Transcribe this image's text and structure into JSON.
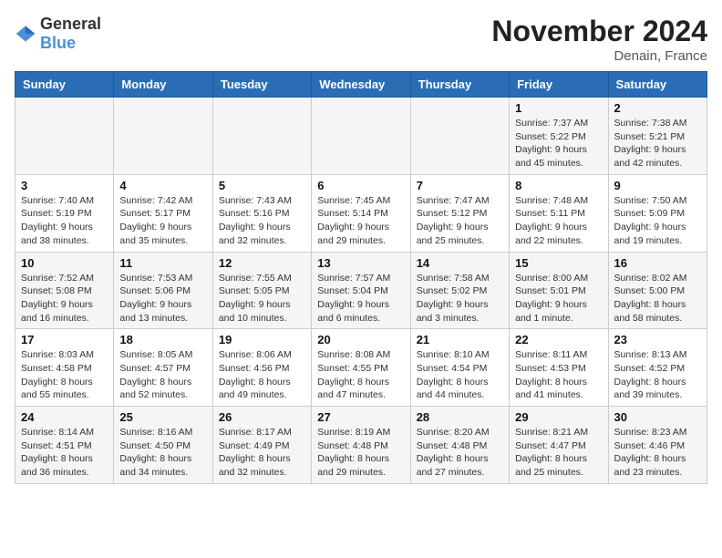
{
  "logo": {
    "general": "General",
    "blue": "Blue"
  },
  "header": {
    "month": "November 2024",
    "location": "Denain, France"
  },
  "days_of_week": [
    "Sunday",
    "Monday",
    "Tuesday",
    "Wednesday",
    "Thursday",
    "Friday",
    "Saturday"
  ],
  "weeks": [
    [
      {
        "day": "",
        "info": ""
      },
      {
        "day": "",
        "info": ""
      },
      {
        "day": "",
        "info": ""
      },
      {
        "day": "",
        "info": ""
      },
      {
        "day": "",
        "info": ""
      },
      {
        "day": "1",
        "info": "Sunrise: 7:37 AM\nSunset: 5:22 PM\nDaylight: 9 hours and 45 minutes."
      },
      {
        "day": "2",
        "info": "Sunrise: 7:38 AM\nSunset: 5:21 PM\nDaylight: 9 hours and 42 minutes."
      }
    ],
    [
      {
        "day": "3",
        "info": "Sunrise: 7:40 AM\nSunset: 5:19 PM\nDaylight: 9 hours and 38 minutes."
      },
      {
        "day": "4",
        "info": "Sunrise: 7:42 AM\nSunset: 5:17 PM\nDaylight: 9 hours and 35 minutes."
      },
      {
        "day": "5",
        "info": "Sunrise: 7:43 AM\nSunset: 5:16 PM\nDaylight: 9 hours and 32 minutes."
      },
      {
        "day": "6",
        "info": "Sunrise: 7:45 AM\nSunset: 5:14 PM\nDaylight: 9 hours and 29 minutes."
      },
      {
        "day": "7",
        "info": "Sunrise: 7:47 AM\nSunset: 5:12 PM\nDaylight: 9 hours and 25 minutes."
      },
      {
        "day": "8",
        "info": "Sunrise: 7:48 AM\nSunset: 5:11 PM\nDaylight: 9 hours and 22 minutes."
      },
      {
        "day": "9",
        "info": "Sunrise: 7:50 AM\nSunset: 5:09 PM\nDaylight: 9 hours and 19 minutes."
      }
    ],
    [
      {
        "day": "10",
        "info": "Sunrise: 7:52 AM\nSunset: 5:08 PM\nDaylight: 9 hours and 16 minutes."
      },
      {
        "day": "11",
        "info": "Sunrise: 7:53 AM\nSunset: 5:06 PM\nDaylight: 9 hours and 13 minutes."
      },
      {
        "day": "12",
        "info": "Sunrise: 7:55 AM\nSunset: 5:05 PM\nDaylight: 9 hours and 10 minutes."
      },
      {
        "day": "13",
        "info": "Sunrise: 7:57 AM\nSunset: 5:04 PM\nDaylight: 9 hours and 6 minutes."
      },
      {
        "day": "14",
        "info": "Sunrise: 7:58 AM\nSunset: 5:02 PM\nDaylight: 9 hours and 3 minutes."
      },
      {
        "day": "15",
        "info": "Sunrise: 8:00 AM\nSunset: 5:01 PM\nDaylight: 9 hours and 1 minute."
      },
      {
        "day": "16",
        "info": "Sunrise: 8:02 AM\nSunset: 5:00 PM\nDaylight: 8 hours and 58 minutes."
      }
    ],
    [
      {
        "day": "17",
        "info": "Sunrise: 8:03 AM\nSunset: 4:58 PM\nDaylight: 8 hours and 55 minutes."
      },
      {
        "day": "18",
        "info": "Sunrise: 8:05 AM\nSunset: 4:57 PM\nDaylight: 8 hours and 52 minutes."
      },
      {
        "day": "19",
        "info": "Sunrise: 8:06 AM\nSunset: 4:56 PM\nDaylight: 8 hours and 49 minutes."
      },
      {
        "day": "20",
        "info": "Sunrise: 8:08 AM\nSunset: 4:55 PM\nDaylight: 8 hours and 47 minutes."
      },
      {
        "day": "21",
        "info": "Sunrise: 8:10 AM\nSunset: 4:54 PM\nDaylight: 8 hours and 44 minutes."
      },
      {
        "day": "22",
        "info": "Sunrise: 8:11 AM\nSunset: 4:53 PM\nDaylight: 8 hours and 41 minutes."
      },
      {
        "day": "23",
        "info": "Sunrise: 8:13 AM\nSunset: 4:52 PM\nDaylight: 8 hours and 39 minutes."
      }
    ],
    [
      {
        "day": "24",
        "info": "Sunrise: 8:14 AM\nSunset: 4:51 PM\nDaylight: 8 hours and 36 minutes."
      },
      {
        "day": "25",
        "info": "Sunrise: 8:16 AM\nSunset: 4:50 PM\nDaylight: 8 hours and 34 minutes."
      },
      {
        "day": "26",
        "info": "Sunrise: 8:17 AM\nSunset: 4:49 PM\nDaylight: 8 hours and 32 minutes."
      },
      {
        "day": "27",
        "info": "Sunrise: 8:19 AM\nSunset: 4:48 PM\nDaylight: 8 hours and 29 minutes."
      },
      {
        "day": "28",
        "info": "Sunrise: 8:20 AM\nSunset: 4:48 PM\nDaylight: 8 hours and 27 minutes."
      },
      {
        "day": "29",
        "info": "Sunrise: 8:21 AM\nSunset: 4:47 PM\nDaylight: 8 hours and 25 minutes."
      },
      {
        "day": "30",
        "info": "Sunrise: 8:23 AM\nSunset: 4:46 PM\nDaylight: 8 hours and 23 minutes."
      }
    ]
  ]
}
